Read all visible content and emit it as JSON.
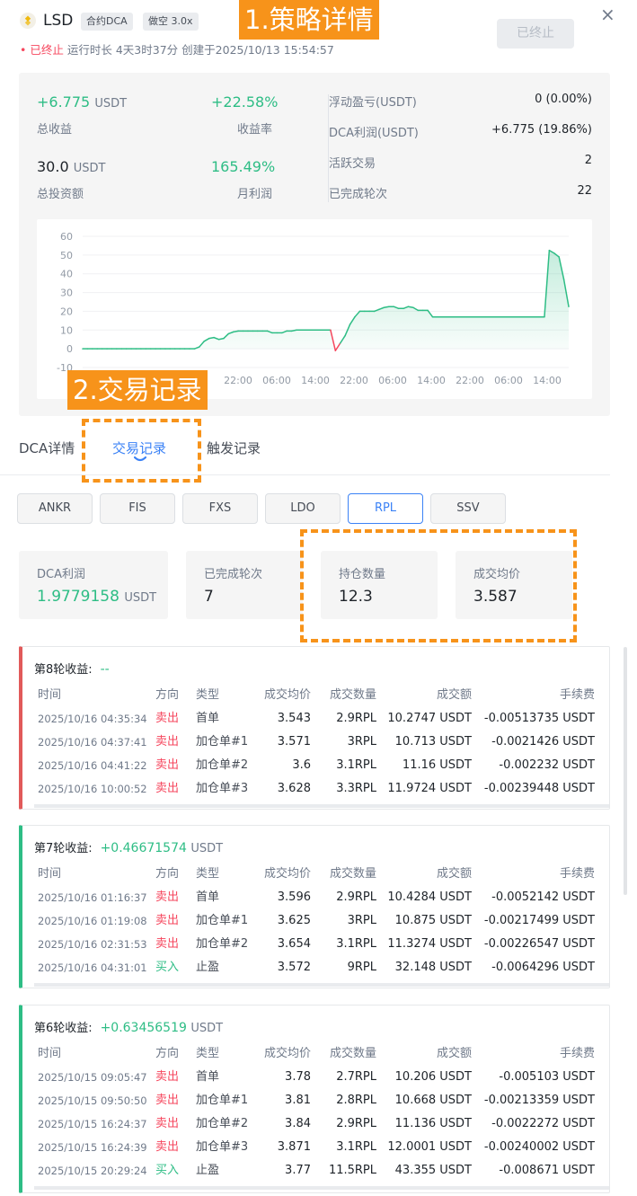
{
  "header": {
    "pair": "LSD",
    "tag_strategy": "合约DCA",
    "tag_direction": "做空 3.0x",
    "status": "已终止",
    "runtime_label": "运行时长",
    "runtime_value": "4天3时37分",
    "created_label": "创建于",
    "created_at": "2025/10/13 15:54:57",
    "stop_button": "已终止",
    "close": "×"
  },
  "annotations": {
    "a1": "1.策略详情",
    "a2": "2.交易记录"
  },
  "overview": {
    "total_profit": "+6.775",
    "total_profit_unit": "USDT",
    "total_profit_label": "总收益",
    "profit_rate": "+22.58%",
    "profit_rate_label": "收益率",
    "total_invest": "30.0",
    "total_invest_unit": "USDT",
    "total_invest_label": "总投资额",
    "monthly_rate": "165.49%",
    "monthly_rate_label": "月利润",
    "right_rows": [
      {
        "label": "浮动盈亏(USDT)",
        "value": "0 (0.00%)"
      },
      {
        "label": "DCA利润(USDT)",
        "value": "+6.775 (19.86%)"
      },
      {
        "label": "活跃交易",
        "value": "2"
      },
      {
        "label": "已完成轮次",
        "value": "22"
      }
    ]
  },
  "chart_data": {
    "type": "area",
    "title": "",
    "xlabel": "",
    "ylabel": "",
    "ylim": [
      -10,
      60
    ],
    "yticks": [
      60,
      50,
      40,
      30,
      20,
      10,
      0,
      -10
    ],
    "x_tick_labels": [
      "22:00",
      "06:00",
      "14:00",
      "22:00",
      "06:00",
      "14:00",
      "22:00",
      "06:00",
      "14:00"
    ],
    "x_ticks_hidden_by_overlay": 2,
    "grid": true,
    "series": [
      {
        "x": [
          0,
          1,
          2,
          3,
          4,
          5,
          6,
          7,
          8,
          9,
          10,
          11,
          12,
          13,
          14,
          15,
          16,
          17,
          18,
          19,
          20,
          21,
          22,
          23,
          24,
          25,
          26,
          27,
          28,
          29,
          30,
          31,
          32,
          33,
          34,
          35,
          36,
          37,
          38,
          39,
          40,
          41,
          42,
          43,
          44,
          45,
          46,
          47,
          48,
          49,
          50,
          51,
          52,
          53,
          54,
          55,
          56,
          57,
          58,
          59,
          60,
          61,
          62,
          63,
          64,
          65,
          66,
          67,
          68,
          69,
          70,
          71,
          72,
          73,
          74,
          75,
          76,
          77,
          78,
          79,
          80,
          81,
          82,
          83,
          84,
          85,
          86,
          87,
          88,
          89,
          90,
          91,
          92,
          93,
          94,
          95,
          96,
          97,
          98,
          99,
          100
        ],
        "values": [
          0,
          0,
          0,
          0,
          0,
          0,
          0,
          0,
          0,
          0,
          0,
          0,
          0,
          0,
          0,
          0,
          0,
          0,
          0,
          0,
          0,
          0,
          0,
          0,
          1,
          4,
          5.5,
          6,
          5,
          5.5,
          8,
          9,
          9.5,
          9.5,
          9.5,
          9.5,
          9.5,
          9.5,
          9.5,
          8.5,
          8.5,
          8.5,
          9.5,
          9.5,
          10,
          10,
          10,
          10,
          10,
          10,
          10,
          10,
          -1,
          3,
          7,
          13,
          17,
          20,
          20,
          20,
          20,
          21,
          22,
          22.5,
          22.5,
          21.5,
          21.5,
          22.5,
          22,
          20.5,
          20.5,
          20.5,
          17,
          17,
          17,
          17,
          17,
          17,
          17,
          17,
          17,
          17,
          17,
          17,
          17,
          17,
          17,
          17,
          17,
          17,
          17,
          17,
          17,
          17,
          17,
          17,
          52.5,
          51,
          49,
          37,
          22.5
        ]
      }
    ]
  },
  "tabs": [
    "DCA详情",
    "交易记录",
    "触发记录"
  ],
  "coins": [
    "ANKR",
    "FIS",
    "FXS",
    "LDO",
    "RPL",
    "SSV"
  ],
  "stats": [
    {
      "label": "DCA利润",
      "value": "1.9779158",
      "unit": "USDT"
    },
    {
      "label": "已完成轮次",
      "value": "7"
    },
    {
      "label": "持仓数量",
      "value": "12.3"
    },
    {
      "label": "成交均价",
      "value": "3.587"
    }
  ],
  "table_headers": [
    "时间",
    "方向",
    "类型",
    "成交均价",
    "成交数量",
    "成交额",
    "手续费"
  ],
  "rounds": [
    {
      "title": "第8轮收益:",
      "profit": "--",
      "profit_unit": "",
      "rows": [
        [
          "2025/10/16 04:35:34",
          "卖出",
          "首单",
          "3.543",
          "2.9RPL",
          "10.2747 USDT",
          "-0.00513735 USDT"
        ],
        [
          "2025/10/16 04:37:41",
          "卖出",
          "加仓单#1",
          "3.571",
          "3RPL",
          "10.713 USDT",
          "-0.0021426 USDT"
        ],
        [
          "2025/10/16 04:41:22",
          "卖出",
          "加仓单#2",
          "3.6",
          "3.1RPL",
          "11.16 USDT",
          "-0.002232 USDT"
        ],
        [
          "2025/10/16 10:00:52",
          "卖出",
          "加仓单#3",
          "3.628",
          "3.3RPL",
          "11.9724 USDT",
          "-0.00239448 USDT"
        ]
      ]
    },
    {
      "title": "第7轮收益:",
      "profit": "+0.46671574",
      "profit_unit": "USDT",
      "rows": [
        [
          "2025/10/16 01:16:37",
          "卖出",
          "首单",
          "3.596",
          "2.9RPL",
          "10.4284 USDT",
          "-0.0052142 USDT"
        ],
        [
          "2025/10/16 01:19:08",
          "卖出",
          "加仓单#1",
          "3.625",
          "3RPL",
          "10.875 USDT",
          "-0.00217499 USDT"
        ],
        [
          "2025/10/16 02:31:53",
          "卖出",
          "加仓单#2",
          "3.654",
          "3.1RPL",
          "11.3274 USDT",
          "-0.00226547 USDT"
        ],
        [
          "2025/10/16 04:31:01",
          "买入",
          "止盈",
          "3.572",
          "9RPL",
          "32.148 USDT",
          "-0.0064296 USDT"
        ]
      ]
    },
    {
      "title": "第6轮收益:",
      "profit": "+0.63456519",
      "profit_unit": "USDT",
      "rows": [
        [
          "2025/10/15 09:05:47",
          "卖出",
          "首单",
          "3.78",
          "2.7RPL",
          "10.206 USDT",
          "-0.005103 USDT"
        ],
        [
          "2025/10/15 09:50:50",
          "卖出",
          "加仓单#1",
          "3.81",
          "2.8RPL",
          "10.668 USDT",
          "-0.00213359 USDT"
        ],
        [
          "2025/10/15 16:24:37",
          "卖出",
          "加仓单#2",
          "3.84",
          "2.9RPL",
          "11.136 USDT",
          "-0.0022272 USDT"
        ],
        [
          "2025/10/15 16:24:39",
          "卖出",
          "加仓单#3",
          "3.871",
          "3.1RPL",
          "12.0001 USDT",
          "-0.00240002 USDT"
        ],
        [
          "2025/10/15 20:29:24",
          "买入",
          "止盈",
          "3.77",
          "11.5RPL",
          "43.355 USDT",
          "-0.008671 USDT"
        ]
      ]
    }
  ],
  "colors": {
    "green": "#2ebd85",
    "red": "#f6465d",
    "accent_blue": "#3b82f6",
    "annotation_orange": "#f7931a"
  }
}
